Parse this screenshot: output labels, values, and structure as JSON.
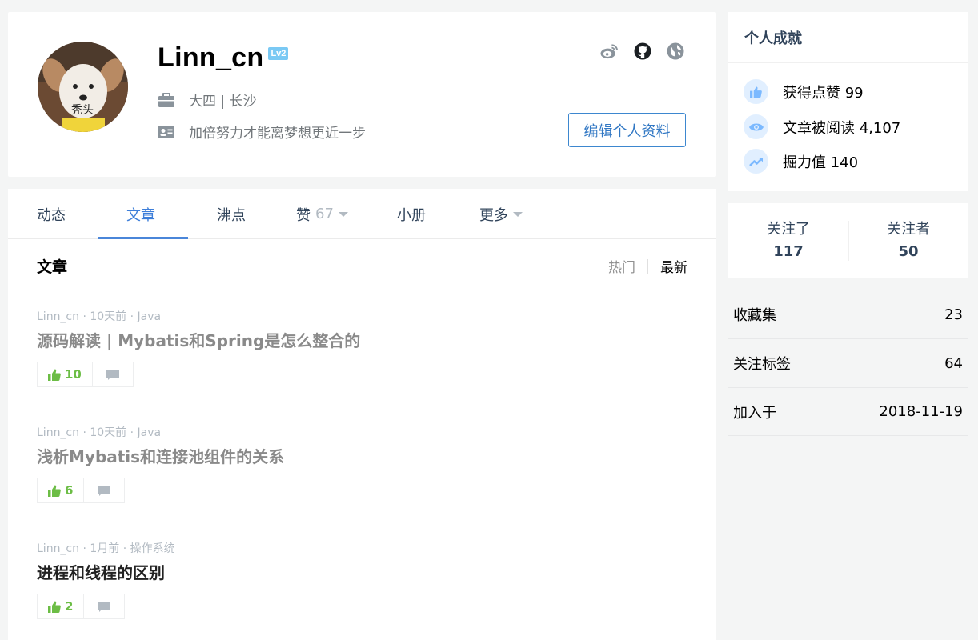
{
  "profile": {
    "username": "Linn_cn",
    "level_badge": "Lv2",
    "avatar_caption": "秃头",
    "job": "大四 | 长沙",
    "intro": "加倍努力才能离梦想更近一步",
    "edit_button": "编辑个人资料",
    "social": [
      "weibo-icon",
      "github-icon",
      "website-icon"
    ]
  },
  "tabs": [
    {
      "label": "动态",
      "active": false
    },
    {
      "label": "文章",
      "active": true
    },
    {
      "label": "沸点",
      "active": false
    },
    {
      "label": "赞",
      "count": "67",
      "dropdown": true
    },
    {
      "label": "小册",
      "active": false
    },
    {
      "label": "更多",
      "dropdown": true
    }
  ],
  "section": {
    "title": "文章",
    "sort_hot": "热门",
    "sort_new": "最新"
  },
  "articles": [
    {
      "author": "Linn_cn",
      "time": "10天前",
      "tag": "Java",
      "meta": "Linn_cn · 10天前 · Java",
      "title": "源码解读 | Mybatis和Spring是怎么整合的",
      "likes": "10"
    },
    {
      "author": "Linn_cn",
      "time": "10天前",
      "tag": "Java",
      "meta": "Linn_cn · 10天前 · Java",
      "title": "浅析Mybatis和连接池组件的关系",
      "likes": "6"
    },
    {
      "author": "Linn_cn",
      "time": "1月前",
      "tag": "操作系统",
      "meta": "Linn_cn · 1月前 · 操作系统",
      "title": "进程和线程的区别",
      "likes": "2"
    }
  ],
  "achievements": {
    "title": "个人成就",
    "likes": "获得点赞 99",
    "reads": "文章被阅读 4,107",
    "power": "掘力值 140"
  },
  "follow": {
    "following_label": "关注了",
    "following_count": "117",
    "followers_label": "关注者",
    "followers_count": "50"
  },
  "stats": [
    {
      "label": "收藏集",
      "value": "23"
    },
    {
      "label": "关注标签",
      "value": "64"
    },
    {
      "label": "加入于",
      "value": "2018-11-19"
    }
  ],
  "colors": {
    "accent": "#3d7ed9",
    "like_green": "#6cbd45",
    "background": "#f4f5f5"
  }
}
